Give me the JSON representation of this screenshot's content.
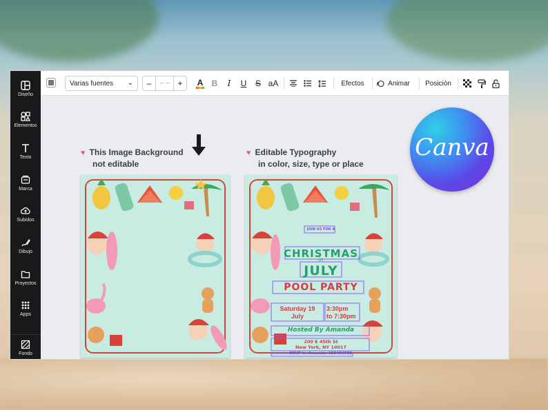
{
  "sidebar": {
    "items": [
      {
        "label": "Diseño",
        "icon": "layout-icon"
      },
      {
        "label": "Elementos",
        "icon": "shapes-icon"
      },
      {
        "label": "Texto",
        "icon": "text-icon"
      },
      {
        "label": "Marca",
        "icon": "brand-icon"
      },
      {
        "label": "Subidos",
        "icon": "upload-icon"
      },
      {
        "label": "Dibujo",
        "icon": "draw-icon"
      },
      {
        "label": "Proyectos",
        "icon": "folder-icon"
      },
      {
        "label": "Apps",
        "icon": "apps-icon"
      },
      {
        "label": "Fondo",
        "icon": "background-icon"
      }
    ]
  },
  "toolbar": {
    "font_family": "Varias fuentes",
    "font_size_decrement": "–",
    "font_size_value": "– –",
    "font_size_increment": "+",
    "text_color_label": "A",
    "bold_label": "B",
    "italic_label": "I",
    "underline_label": "U",
    "strikethrough_label": "S",
    "case_label": "aA",
    "effects_label": "Efectos",
    "animate_label": "Animar",
    "position_label": "Posición"
  },
  "captions": {
    "left_line1": "This Image Background",
    "left_line2": "not editable",
    "right_line1": "Editable Typography",
    "right_line2": "in color, size, type or place",
    "heart": "♥"
  },
  "invitation": {
    "join_us": "JOIN US FOR A",
    "line1": "CHRISTMAS",
    "line2": "in",
    "line3": "JULY",
    "line4": "POOL PARTY",
    "date_line1": "Saturday 19",
    "date_line2": "July",
    "time_line1": "3:30pm",
    "time_line2": "to 7:30pm",
    "hosted_by": "Hosted By Amanda",
    "address_line1": "200 E 45th St",
    "address_line2": "New York, NY 10017",
    "rsvp": "RSVP to Amanda: 123456789"
  },
  "badge": {
    "brand": "Canva"
  },
  "colors": {
    "sidebar_bg": "#18191b",
    "page_bg": "#c9ece2",
    "frame_red": "#d9423a",
    "invite_green": "#2a9d6e",
    "invite_purple": "#7a4bd0",
    "invite_red": "#d23c45",
    "heart": "#e0607e"
  }
}
